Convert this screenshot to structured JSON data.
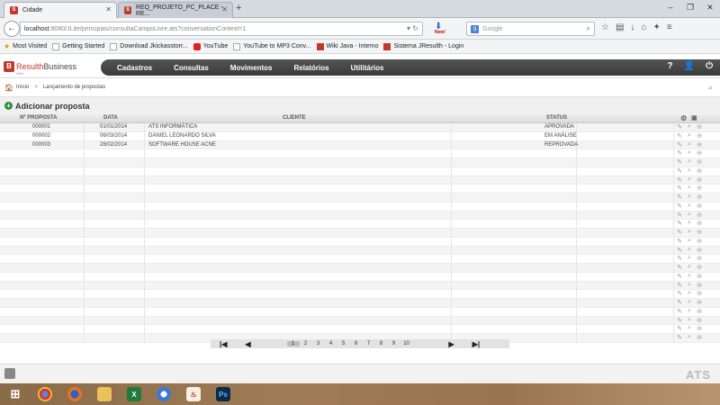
{
  "browser": {
    "tabs": [
      {
        "title": "Cidade",
        "active": true
      },
      {
        "title": "REQ_PROJETO_PC_PLACE - RE...",
        "active": false
      }
    ],
    "url_host": "localhost",
    "url_path": ":8080/JLite/principais/consultaCampoLivre.ats?conversationContext=1",
    "search_placeholder": "Google",
    "download_badge": "New!",
    "bookmarks": [
      {
        "label": "Most Visited",
        "icon": "star-icon"
      },
      {
        "label": "Getting Started",
        "icon": "page-icon"
      },
      {
        "label": "Download Jkickasstorr...",
        "icon": "page-icon"
      },
      {
        "label": "YouTube",
        "icon": "youtube-icon"
      },
      {
        "label": "YouTube to MP3 Conv...",
        "icon": "page-icon"
      },
      {
        "label": "Wiki Java - Interno",
        "icon": "wiki-icon"
      },
      {
        "label": "Sistema JResulth - Login",
        "icon": "app-icon"
      }
    ]
  },
  "app": {
    "logo": {
      "part1": "Resulth",
      "part2": "Business",
      "sub": "Web"
    },
    "menu": [
      "Cadastros",
      "Consultas",
      "Movimentos",
      "Relatórios",
      "Utilitários"
    ],
    "header_icons": {
      "help": "?",
      "user": "user-icon",
      "power": "power-icon"
    },
    "breadcrumb": {
      "home": "Início",
      "separator": ">",
      "current": "Lançamento de propostas"
    },
    "add_label": "Adicionar proposta",
    "columns": {
      "num": "Nº PROPOSTA",
      "date": "DATA",
      "client": "CLIENTE",
      "status": "STATUS"
    },
    "rows": [
      {
        "num": "000001",
        "date": "01/01/2014",
        "client": "ATS INFORMÁTICA",
        "status": "APROVADA"
      },
      {
        "num": "000002",
        "date": "06/03/2014",
        "client": "DANIEL LEONARDO SILVA",
        "status": "EM ANÁLISE"
      },
      {
        "num": "000003",
        "date": "28/02/2014",
        "client": "SOFTWARE HOUSE ACNE",
        "status": "REPROVADA"
      }
    ],
    "empty_rows": 22,
    "pages": [
      "1",
      "2",
      "3",
      "4",
      "5",
      "6",
      "7",
      "8",
      "9",
      "10"
    ],
    "current_page": "1",
    "footer_brand": "ATS"
  },
  "taskbar": {
    "apps": [
      "windows-start-icon",
      "chrome-icon",
      "firefox-icon",
      "explorer-icon",
      "excel-icon",
      "itunes-icon",
      "java-icon",
      "photoshop-icon"
    ],
    "labels": {
      "excel": "X",
      "photoshop": "Ps"
    }
  }
}
